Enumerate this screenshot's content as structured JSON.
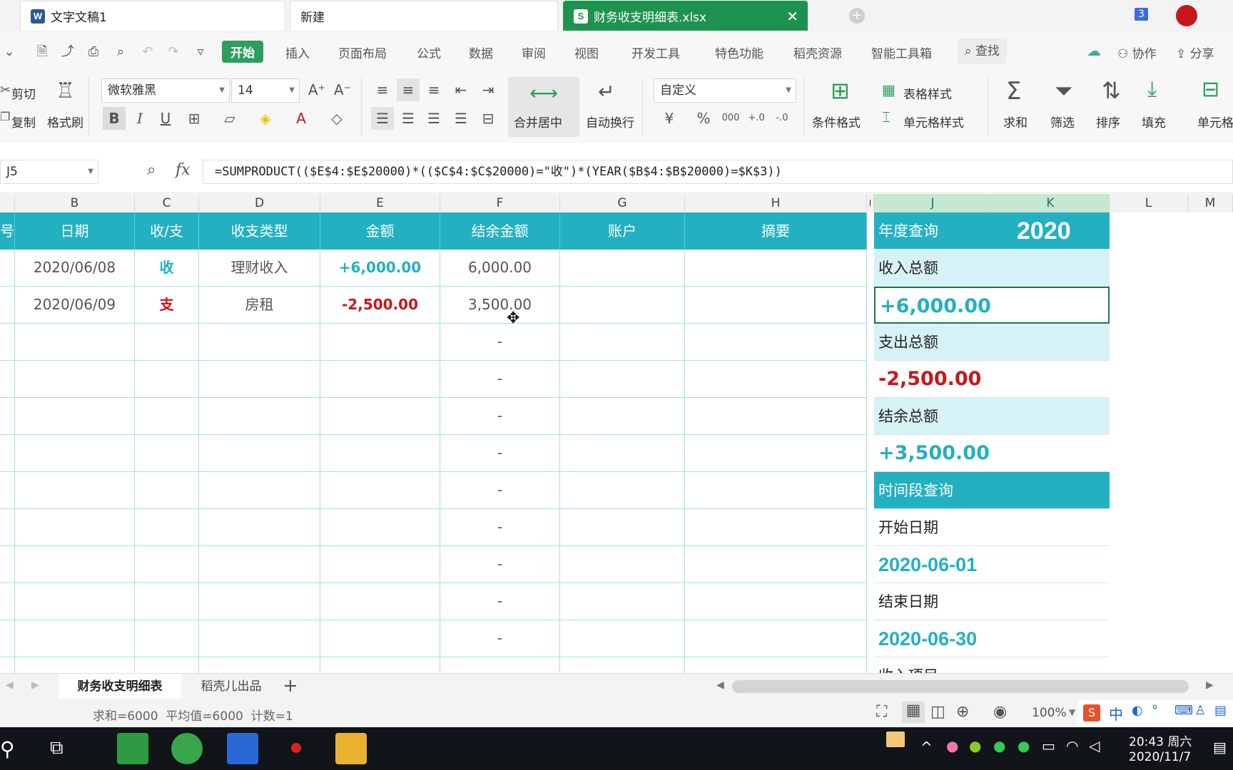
{
  "titlebar": {
    "tabs": [
      {
        "label": "文字文稿1",
        "icon": "word-doc-icon"
      },
      {
        "label": "新建",
        "icon": ""
      },
      {
        "label": "财务收支明细表.xlsx",
        "icon": "spreadsheet-icon"
      }
    ],
    "window_count_badge": "3"
  },
  "menu": {
    "items": [
      "开始",
      "插入",
      "页面布局",
      "公式",
      "数据",
      "审阅",
      "视图",
      "开发工具",
      "特色功能",
      "稻壳资源",
      "智能工具箱"
    ],
    "search_label": "查找",
    "collab_label": "协作",
    "share_label": "分享"
  },
  "ribbon": {
    "cut_label": "剪切",
    "copy_label": "复制",
    "format_painter_label": "格式刷",
    "font_name": "微软雅黑",
    "font_size": "14",
    "merge_center_label": "合并居中",
    "wrap_text_label": "自动换行",
    "number_format": "自定义",
    "conditional_format_label": "条件格式",
    "table_style_label": "表格样式",
    "cell_style_label": "单元格样式",
    "sum_label": "求和",
    "filter_label": "筛选",
    "sort_label": "排序",
    "fill_label": "填充",
    "cell_label": "单元格",
    "num_currency": "¥",
    "num_percent": "%",
    "num_thousands": "000",
    "num_inc_decimal": "+.0",
    "num_dec_decimal": "-.0"
  },
  "formula_bar": {
    "cell_ref": "J5",
    "fx_label": "fx",
    "formula": "=SUMPRODUCT(($E$4:$E$20000)*(($C$4:$C$20000)=\"收\")*(YEAR($B$4:$B$20000)=$K$3))"
  },
  "columns": [
    "B",
    "C",
    "D",
    "E",
    "F",
    "G",
    "H",
    "I",
    "J",
    "K",
    "L",
    "M"
  ],
  "table": {
    "first_header_partial": "号",
    "headers": [
      "日期",
      "收/支",
      "收支类型",
      "金额",
      "结余金额",
      "账户",
      "摘要"
    ],
    "rows": [
      {
        "date": "2020/06/08",
        "type": "收",
        "category": "理财收入",
        "amount": "+6,000.00",
        "balance": "6,000.00",
        "account": "",
        "note": ""
      },
      {
        "date": "2020/06/09",
        "type": "支",
        "category": "房租",
        "amount": "-2,500.00",
        "balance": "3,500.00",
        "account": "",
        "note": ""
      }
    ],
    "empty_balance": "-"
  },
  "side_panel": {
    "year_query_label": "年度查询",
    "year_value": "2020",
    "income_label": "收入总额",
    "income_value": "+6,000.00",
    "expense_label": "支出总额",
    "expense_value": "-2,500.00",
    "balance_label": "结余总额",
    "balance_value": "+3,500.00",
    "period_query_label": "时间段查询",
    "start_date_label": "开始日期",
    "start_date_value": "2020-06-01",
    "end_date_label": "结束日期",
    "end_date_value": "2020-06-30",
    "partial_next_label": "收入项目"
  },
  "sheet_tabs": [
    "财务收支明细表",
    "稻壳儿出品"
  ],
  "status": {
    "summary": "求和=6000  平均值=6000  计数=1",
    "zoom": "100%"
  },
  "taskbar": {
    "time": "20:43 周六",
    "date": "2020/11/7",
    "ime": "中"
  },
  "colors": {
    "accent_teal": "#23b0c1",
    "income_color": "#23b0c1",
    "expense_color": "#c8161d",
    "active_tab_green": "#1e9350"
  }
}
